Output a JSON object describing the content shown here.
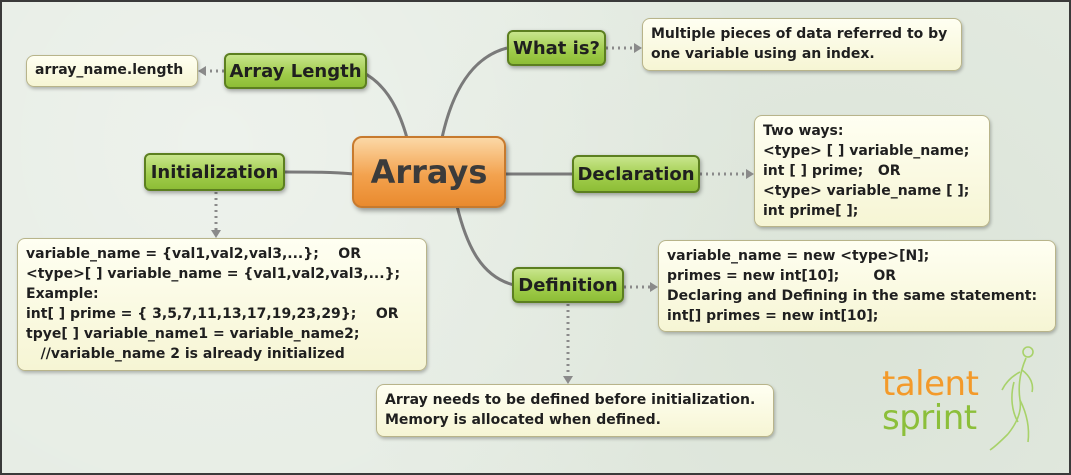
{
  "center": {
    "label": "Arrays"
  },
  "topics": {
    "what_is": "What is?",
    "array_length": "Array Length",
    "initialization": "Initialization",
    "declaration": "Declaration",
    "definition": "Definition"
  },
  "notes": {
    "what_is": [
      "Multiple pieces of data referred to by",
      "one variable using an index."
    ],
    "array_length": [
      "array_name.length"
    ],
    "declaration": [
      "Two ways:",
      "<type> [ ] variable_name;",
      "int [ ] prime;   OR",
      "<type> variable_name [ ];",
      "int prime[ ];"
    ],
    "definition": [
      "variable_name = new <type>[N];",
      "primes = new int[10];       OR",
      "Declaring and Defining in the same statement:",
      "int[] primes = new int[10];"
    ],
    "initialization": [
      "variable_name = {val1,val2,val3,...};    OR",
      "<type>[ ] variable_name = {val1,val2,val3,...};",
      "Example:",
      "int[ ] prime = { 3,5,7,11,13,17,19,23,29};    OR",
      "tpye[ ] variable_name1 = variable_name2;",
      "   //variable_name 2 is already initialized"
    ],
    "definition_extra": [
      "Array needs to be defined before initialization.",
      "Memory is allocated when defined."
    ]
  },
  "logo": {
    "line1": "talent",
    "line2": "sprint"
  },
  "colors": {
    "center_fill": "#f3a24e",
    "topic_fill": "#9fcc4a",
    "note_fill": "#f8f7dc",
    "link_color": "#7a7a7a",
    "logo_orange": "#f39a2a",
    "logo_green": "#8cbf3a"
  }
}
